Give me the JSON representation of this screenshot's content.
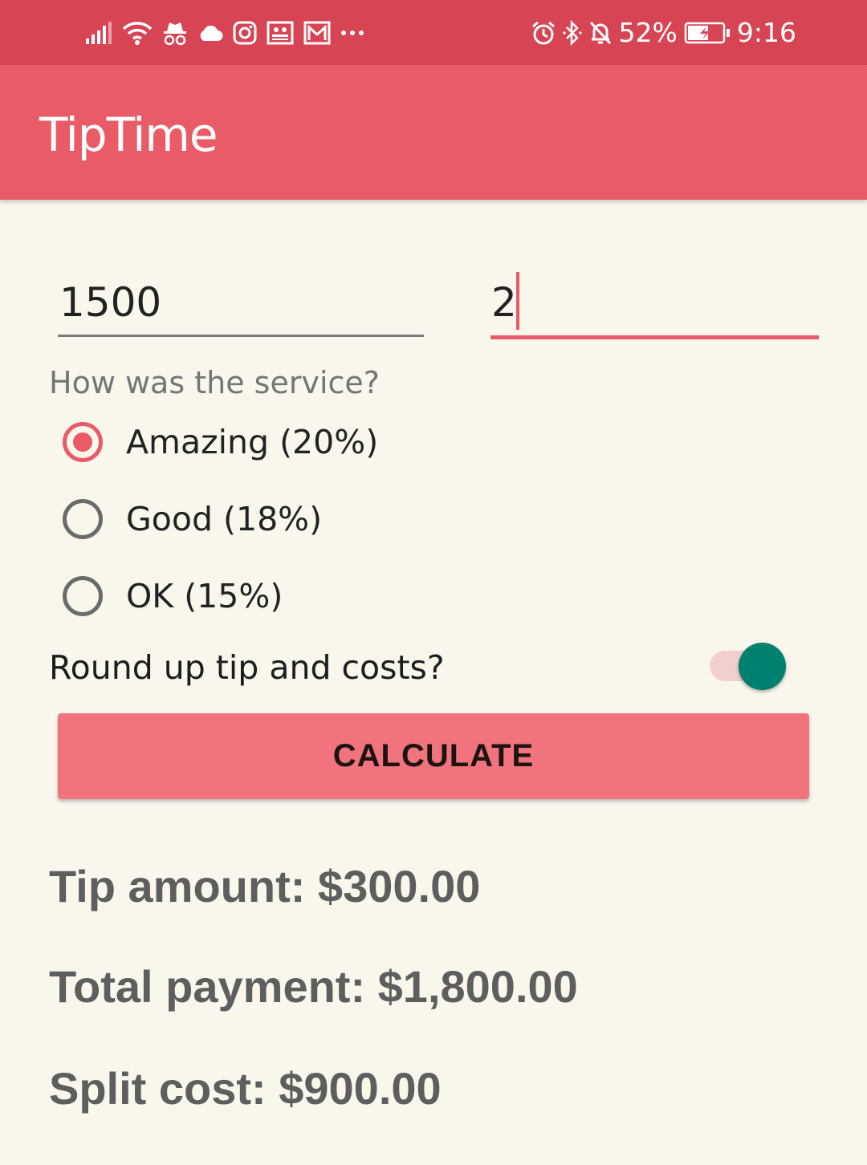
{
  "status_bar": {
    "left_icons": [
      "signal-icon",
      "wifi-icon",
      "incognito-icon",
      "cloud-icon",
      "instagram-icon",
      "news-icon",
      "gmail-icon",
      "more-notifications-icon"
    ],
    "right_icons": [
      "alarm-icon",
      "bluetooth-icon",
      "notifications-off-icon",
      "battery-charging-icon"
    ],
    "battery": "52%",
    "time": "9:16"
  },
  "app_bar": {
    "title": "TipTime"
  },
  "form": {
    "cost_value": "1500",
    "people_value": "2",
    "service_question": "How was the service?",
    "options": [
      {
        "label": "Amazing (20%)",
        "checked": true
      },
      {
        "label": "Good (18%)",
        "checked": false
      },
      {
        "label": "OK (15%)",
        "checked": false
      }
    ],
    "round_up_label": "Round up tip and costs?",
    "round_up_on": true,
    "calculate_label": "CALCULATE"
  },
  "results": {
    "tip": "Tip amount: $300.00",
    "total": "Total payment: $1,800.00",
    "split": "Split cost: $900.00"
  },
  "colors": {
    "status_bar": "#d74453",
    "app_bar": "#e95b66",
    "accent": "#e95b66",
    "button": "#f0737d",
    "switch_thumb": "#00806f",
    "background": "#f9f7ec"
  }
}
